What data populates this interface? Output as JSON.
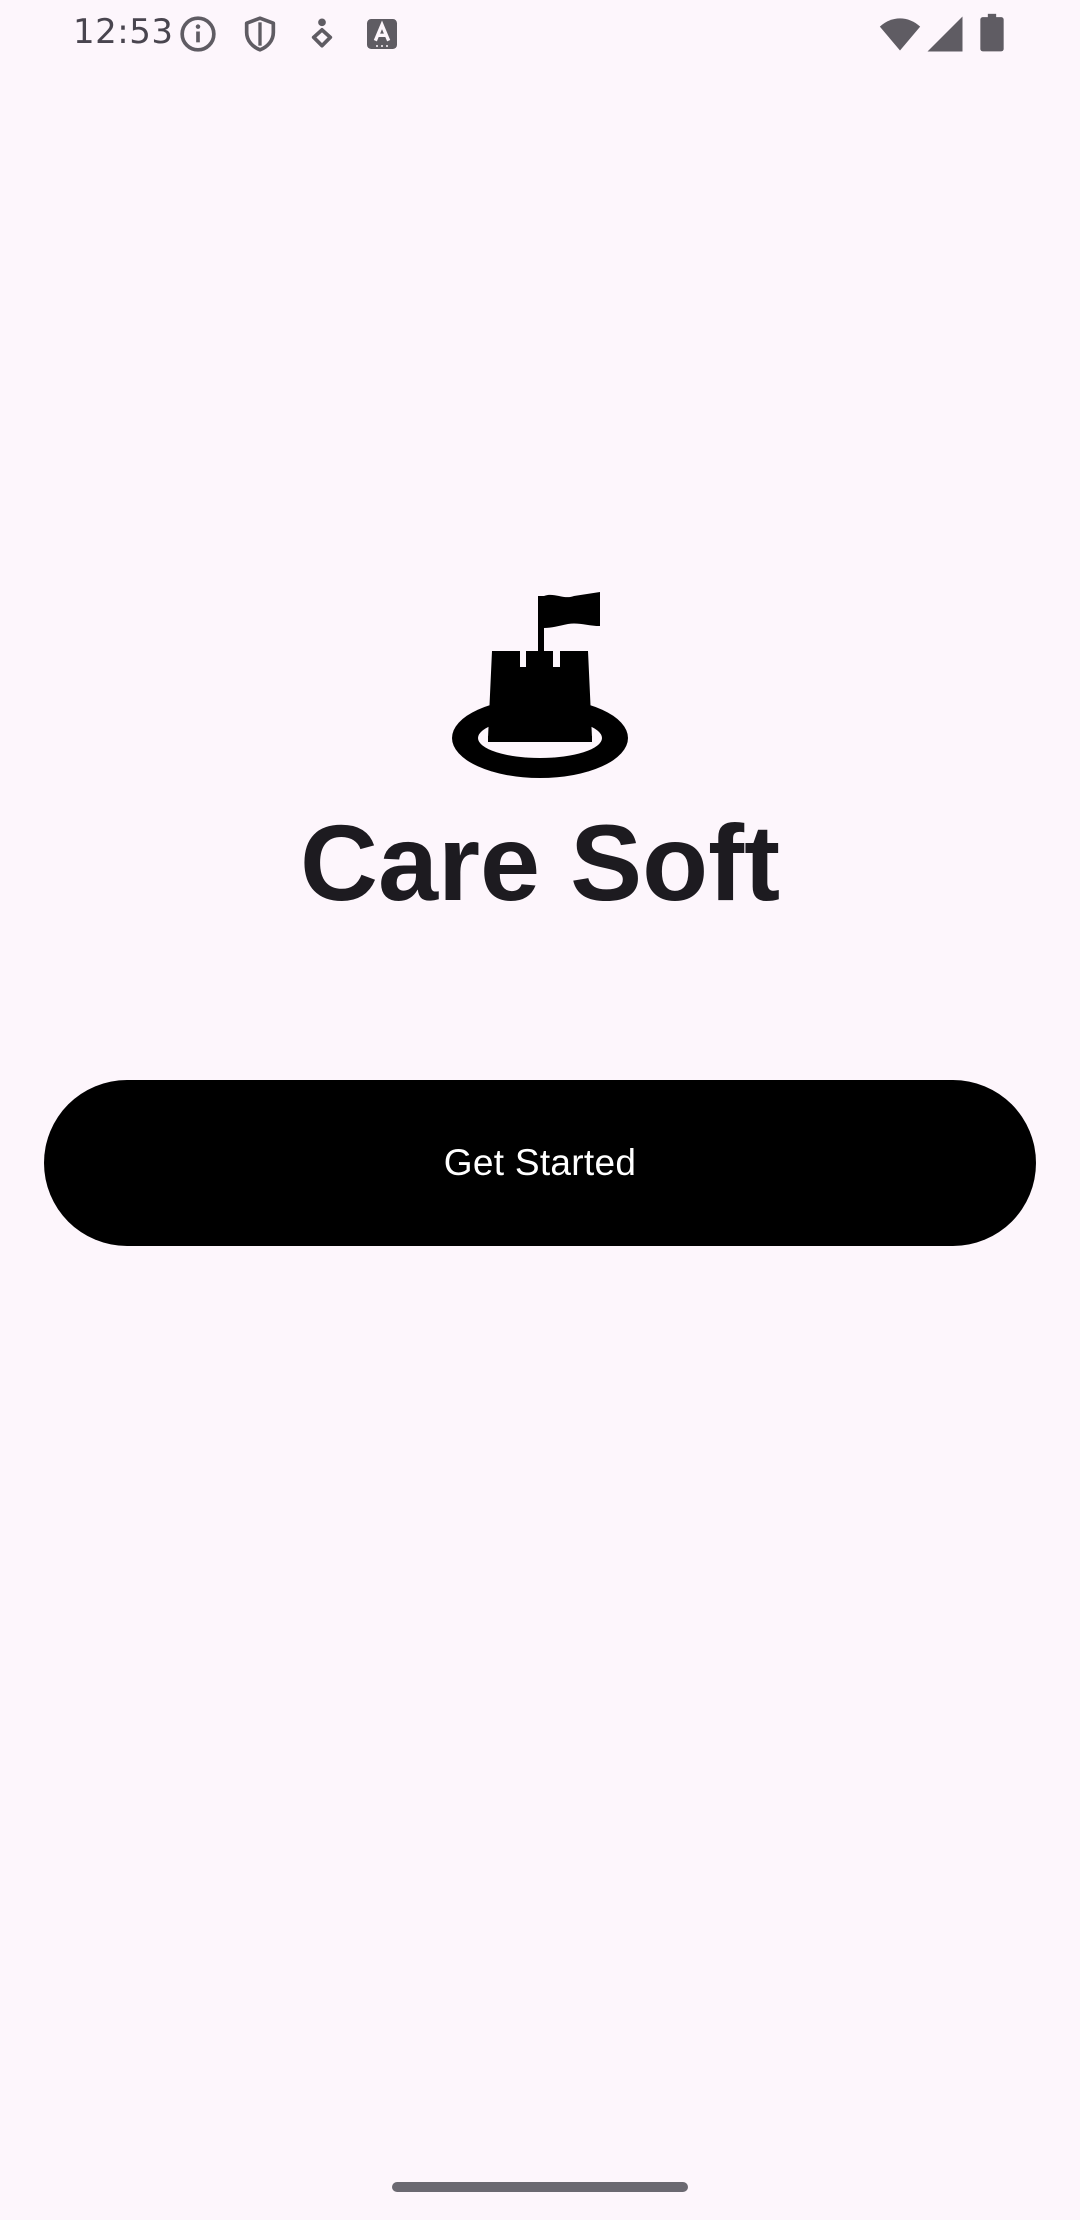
{
  "status_bar": {
    "time": "12:53",
    "icons_left": [
      "info-icon",
      "shield-icon",
      "accessibility-icon",
      "text-a-icon"
    ],
    "icons_right": [
      "wifi-icon",
      "signal-icon",
      "battery-icon"
    ]
  },
  "app": {
    "title": "Care Soft",
    "logo": "sandcastle-icon"
  },
  "actions": {
    "get_started_label": "Get Started"
  },
  "colors": {
    "background": "#fdf6fc",
    "button": "#000000",
    "button_text": "#ffffff",
    "title": "#1d1b20",
    "status_icons": "#5f5c63"
  }
}
